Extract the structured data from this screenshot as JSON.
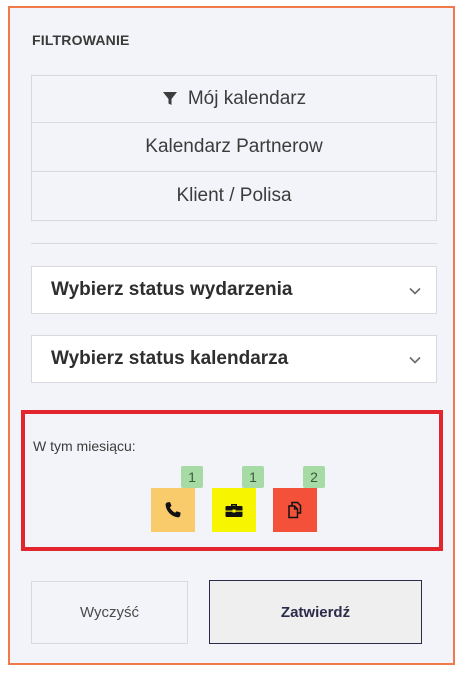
{
  "panel": {
    "title": "FILTROWANIE"
  },
  "filters": {
    "my_calendar": "Mój kalendarz",
    "partners_calendar": "Kalendarz Partnerow",
    "client_policy": "Klient / Polisa"
  },
  "selects": {
    "event_status": "Wybierz status wydarzenia",
    "calendar_status": "Wybierz status kalendarza"
  },
  "month": {
    "label": "W tym miesiącu:",
    "items": [
      {
        "icon": "phone-icon",
        "count": "1",
        "color": "#f9cb6a"
      },
      {
        "icon": "briefcase-icon",
        "count": "1",
        "color": "#f8f500"
      },
      {
        "icon": "copy-icon",
        "count": "2",
        "color": "#f4513a"
      }
    ]
  },
  "actions": {
    "clear": "Wyczyść",
    "submit": "Zatwierdź"
  },
  "colors": {
    "panel_border": "#f07a4a",
    "highlight_border": "#e3262e",
    "badge": "#a6dba6"
  }
}
